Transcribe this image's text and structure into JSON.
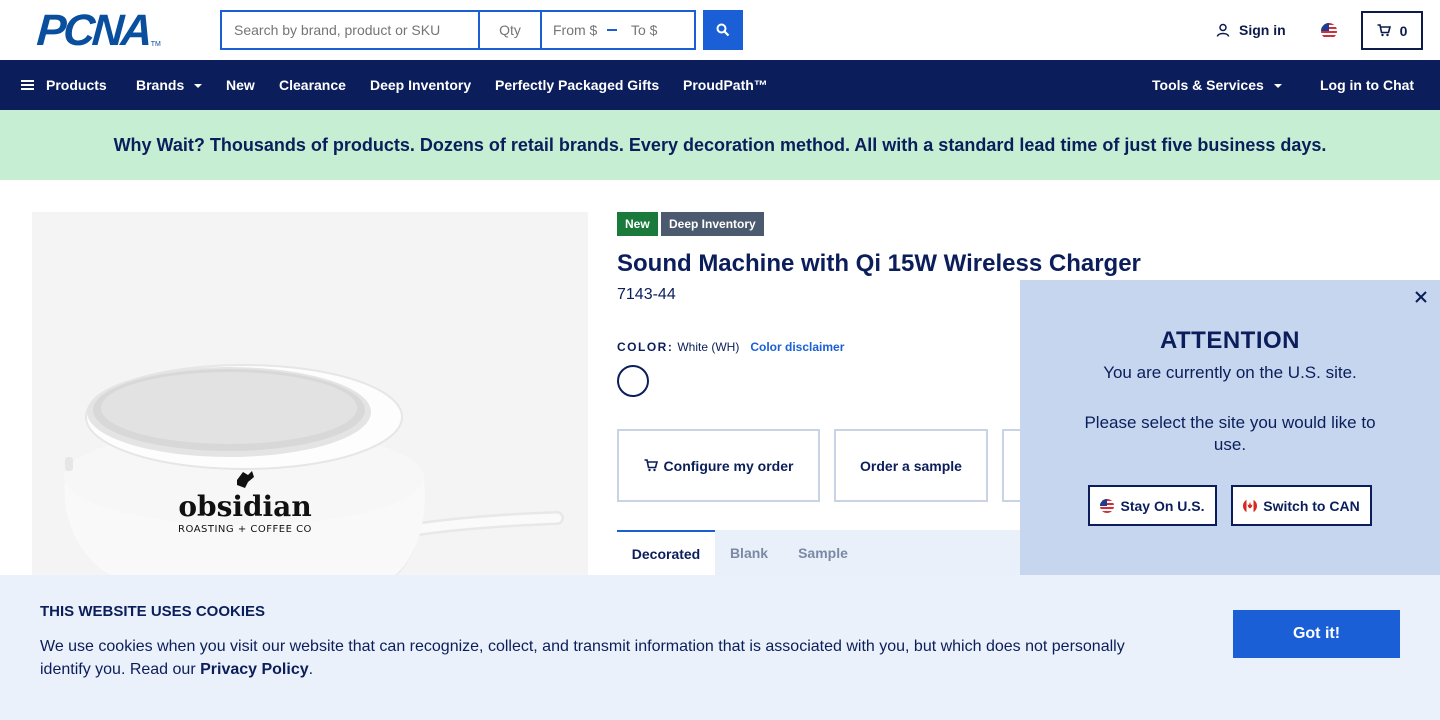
{
  "header": {
    "logo_text": "PCNA",
    "logo_tm": "TM",
    "search_placeholder": "Search by brand, product or SKU",
    "qty_placeholder": "Qty",
    "price_from_placeholder": "From $",
    "price_to_placeholder": "To $",
    "sign_in_label": "Sign in",
    "cart_count": "0",
    "search_icon": "search-icon",
    "user_icon": "user-icon",
    "cart_icon": "cart-icon",
    "region_flag": "us-flag-icon"
  },
  "nav": {
    "products": "Products",
    "brands": "Brands",
    "new": "New",
    "clearance": "Clearance",
    "deep_inventory": "Deep Inventory",
    "packaged_gifts": "Perfectly Packaged Gifts",
    "proudpath": "ProudPath™",
    "tools_services": "Tools & Services",
    "chat_login": "Log in to Chat"
  },
  "promo": {
    "text": "Why Wait? Thousands of products. Dozens of retail brands. Every decoration method. All with a standard lead time of just five business days."
  },
  "product": {
    "badge_new": "New",
    "badge_deep": "Deep Inventory",
    "title": "Sound Machine with Qi 15W Wireless Charger",
    "sku": "7143-44",
    "color_label": "COLOR:",
    "color_value": "White (WH)",
    "color_disclaimer": "Color disclaimer",
    "image_brand": "obsidian",
    "image_brand_sub": "ROASTING + COFFEE CO",
    "actions": {
      "configure": "Configure my order",
      "sample": "Order a sample"
    },
    "tabs": [
      "Decorated",
      "Blank",
      "Sample"
    ]
  },
  "attention": {
    "title": "ATTENTION",
    "message": "You are currently on the U.S. site.",
    "message2": "Please select the site you would like to use.",
    "stay_label": "Stay On U.S.",
    "switch_label": "Switch to CAN",
    "close_icon": "close-icon"
  },
  "cookie": {
    "title": "THIS WEBSITE USES COOKIES",
    "text_before": "We use cookies when you visit our website that can recognize, collect, and transmit information that is associated with you, but which does not personally identify you. Read our ",
    "link": "Privacy Policy",
    "text_after": ".",
    "button": "Got it!"
  },
  "colors": {
    "navy": "#0b1e5b",
    "blue": "#1a5fd6",
    "promo_green": "#c5eed3",
    "badge_new": "#1a7a3c",
    "badge_deep": "#4b5a6e",
    "attention_bg": "#c5d6ee",
    "cookie_bg": "#eaf1fa"
  }
}
